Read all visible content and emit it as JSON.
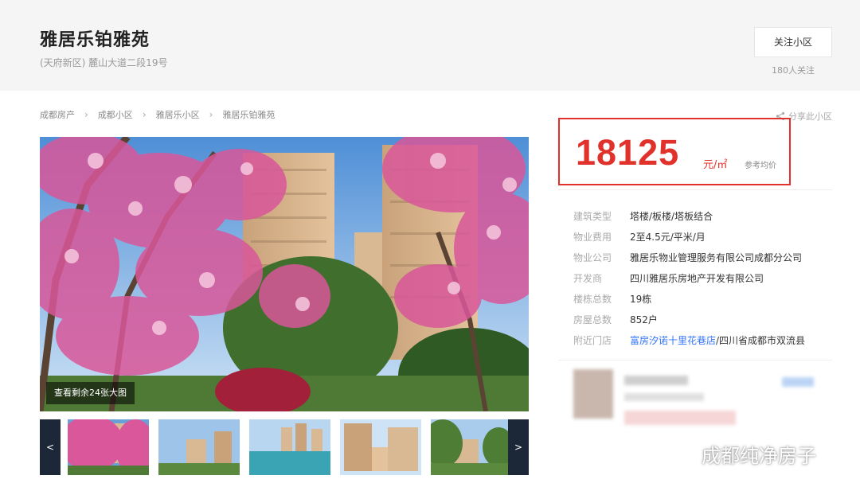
{
  "header": {
    "title": "雅居乐铂雅苑",
    "address": "(天府新区) 麓山大道二段19号",
    "follow_label": "关注小区",
    "follow_count": "180人关注"
  },
  "breadcrumb": [
    "成都房产",
    "成都小区",
    "雅居乐小区",
    "雅居乐铂雅苑"
  ],
  "share_label": "分享此小区",
  "gallery": {
    "photo_count_label": "查看剩余24张大图",
    "prev_label": "<",
    "next_label": ">"
  },
  "price": {
    "value": "18125",
    "unit": "元/㎡",
    "ref_label": "参考均价"
  },
  "info": [
    {
      "label": "建筑类型",
      "value": "塔楼/板楼/塔板结合"
    },
    {
      "label": "物业费用",
      "value": "2至4.5元/平米/月"
    },
    {
      "label": "物业公司",
      "value": "雅居乐物业管理服务有限公司成都分公司"
    },
    {
      "label": "开发商",
      "value": "四川雅居乐房地产开发有限公司"
    },
    {
      "label": "楼栋总数",
      "value": "19栋"
    },
    {
      "label": "房屋总数",
      "value": "852户"
    }
  ],
  "nearby_store": {
    "label": "附近门店",
    "link": "富房汐诺十里花巷店",
    "location": "/四川省成都市双流县"
  },
  "watermark": "成都纯净房子",
  "colors": {
    "price_red": "#e0312a",
    "link_blue": "#3072f6",
    "header_bg": "#f5f5f5",
    "thumb_nav": "#1c2838"
  }
}
